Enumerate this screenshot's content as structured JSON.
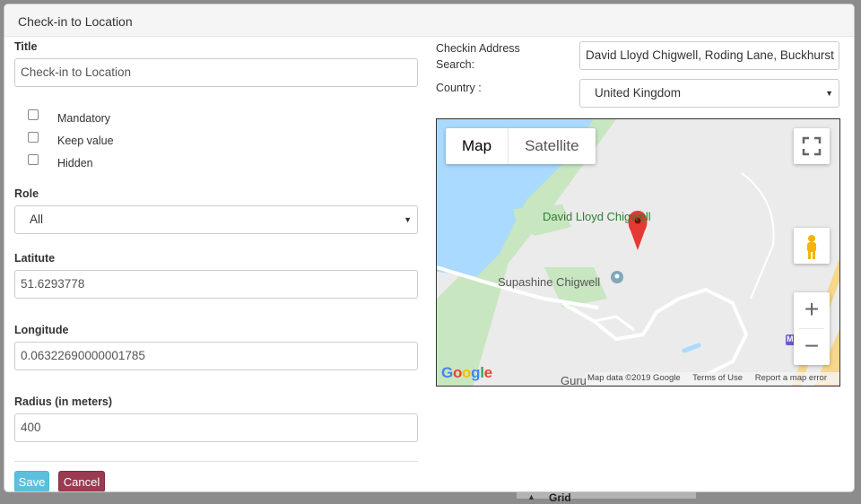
{
  "backdrop": {
    "label": "Grid"
  },
  "modal": {
    "title": "Check-in to Location"
  },
  "form": {
    "title_label": "Title",
    "title_value": "Check-in to Location",
    "checkboxes": [
      {
        "label": "Mandatory",
        "checked": false
      },
      {
        "label": "Keep value",
        "checked": false
      },
      {
        "label": "Hidden",
        "checked": false
      }
    ],
    "role_label": "Role",
    "role_value": "All",
    "latitude_label": "Latitute",
    "latitude_value": "51.6293778",
    "longitude_label": "Longitude",
    "longitude_value": "0.06322690000001785",
    "radius_label": "Radius (in meters)",
    "radius_value": "400",
    "save_label": "Save",
    "cancel_label": "Cancel"
  },
  "right": {
    "address_label": "Checkin Address Search:",
    "address_value": "David Lloyd Chigwell, Roding Lane, Buckhurst",
    "country_label": "Country :",
    "country_value": "United Kingdom"
  },
  "map": {
    "map_type_options": [
      "Map",
      "Satellite"
    ],
    "map_type_selected": "Map",
    "places": [
      "David Lloyd Chigwell",
      "Supashine Chigwell",
      "Guru"
    ],
    "road_badge": "M",
    "logo": "Google",
    "map_data": "Map data ©2019 Google",
    "terms": "Terms of Use",
    "report": "Report a map error",
    "colors": {
      "water": "#aadaff",
      "park": "#c8e6c0",
      "road": "#ffffff",
      "highway": "#f6d78b",
      "marker": "#e53935"
    }
  }
}
